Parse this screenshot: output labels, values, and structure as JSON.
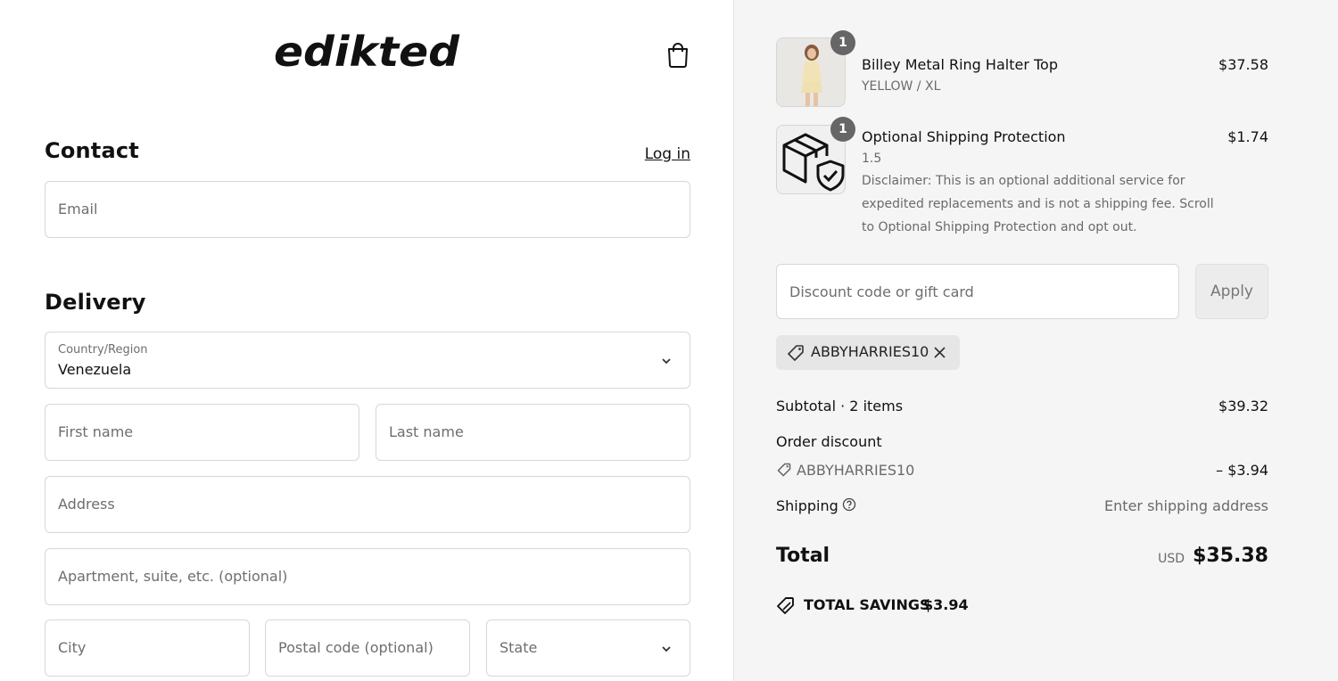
{
  "brand": {
    "logo_text": "edikted",
    "cart_icon": "shopping-bag-icon"
  },
  "contact": {
    "title": "Contact",
    "login_label": "Log in",
    "email_placeholder": "Email"
  },
  "delivery": {
    "title": "Delivery",
    "country_label": "Country/Region",
    "country_value": "Venezuela",
    "first_name_placeholder": "First name",
    "last_name_placeholder": "Last name",
    "address_placeholder": "Address",
    "apartment_placeholder": "Apartment, suite, etc. (optional)",
    "city_placeholder": "City",
    "postal_placeholder": "Postal code (optional)",
    "state_placeholder": "State"
  },
  "cart": {
    "items": [
      {
        "name": "Billey Metal Ring Halter Top",
        "variant": "YELLOW / XL",
        "price": "$37.58",
        "qty": "1"
      },
      {
        "name": "Optional Shipping Protection",
        "variant": "1.5",
        "price": "$1.74",
        "qty": "1",
        "disclaimer": "Disclaimer: This is an optional additional service for expedited replacements and is not a shipping fee. Scroll to Optional Shipping Protection and opt out."
      }
    ],
    "discount_placeholder": "Discount code or gift card",
    "apply_label": "Apply",
    "applied_code": "ABBYHARRIES10"
  },
  "summary": {
    "subtotal_label": "Subtotal · 2 items",
    "subtotal_value": "$39.32",
    "order_discount_label": "Order discount",
    "discount_code": "ABBYHARRIES10",
    "discount_value": "– $3.94",
    "shipping_label": "Shipping",
    "shipping_value": "Enter shipping address",
    "total_label": "Total",
    "currency": "USD",
    "total_value": "$35.38",
    "savings_label": "TOTAL SAVINGS",
    "savings_value": "$3.94"
  },
  "colors": {
    "sidebar_bg": "#f5f5f5",
    "badge_bg": "#666666",
    "border": "#d7d7d7"
  }
}
